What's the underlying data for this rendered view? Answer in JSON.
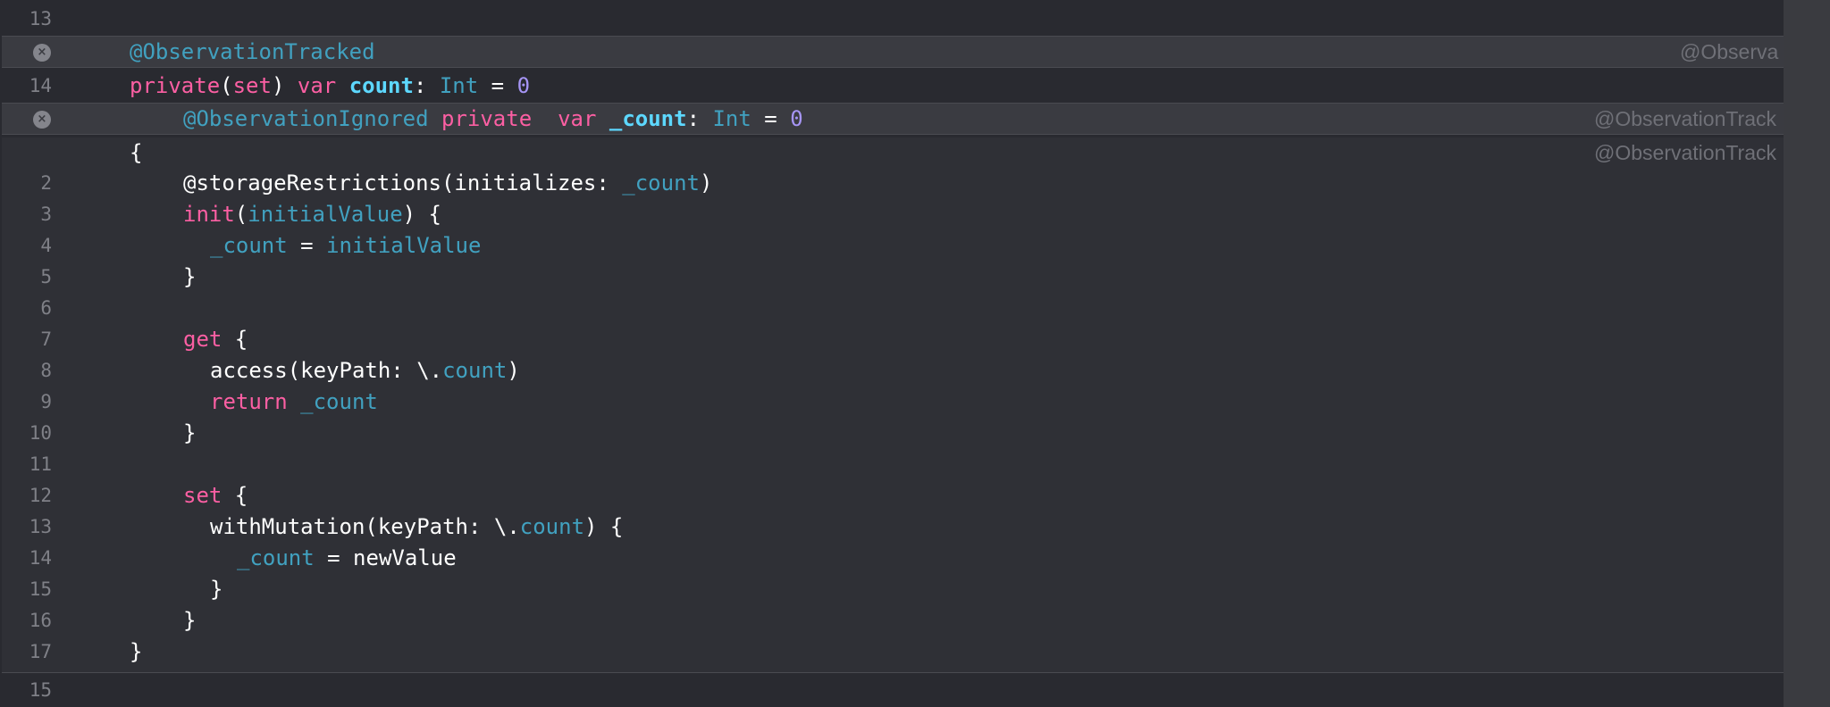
{
  "top_line": {
    "number": "13",
    "text": ""
  },
  "banner1": {
    "code": "@ObservationTracked",
    "hint": "@Observa"
  },
  "line14": {
    "number": "14",
    "tokens": {
      "t1": "private",
      "t2": "(",
      "t3": "set",
      "t4": ") ",
      "t5": "var",
      "t6": " ",
      "t7": "count",
      "t8": ": ",
      "t9": "Int",
      "t10": " = ",
      "t11": "0"
    }
  },
  "banner2": {
    "tokens": {
      "t1": "@ObservationIgnored",
      "t2": " ",
      "t3": "private",
      "t4": "  ",
      "t5": "var",
      "t6": " ",
      "t7": "_count",
      "t8": ": ",
      "t9": "Int",
      "t10": " = ",
      "t11": "0"
    },
    "hint": "@ObservationTrack"
  },
  "expansion": {
    "hint": "@ObservationTrack",
    "open_brace": "{",
    "lines": [
      {
        "number": "2",
        "parts": [
          "@storageRestrictions(initializes: ",
          "_count",
          ")"
        ]
      },
      {
        "number": "3",
        "parts": [
          "init",
          "(",
          "initialValue",
          ") {"
        ]
      },
      {
        "number": "4",
        "parts": [
          "_count",
          " = ",
          "initialValue"
        ]
      },
      {
        "number": "5",
        "parts": [
          "}"
        ]
      },
      {
        "number": "6",
        "parts": [
          ""
        ]
      },
      {
        "number": "7",
        "parts": [
          "get",
          " {"
        ]
      },
      {
        "number": "8",
        "parts": [
          "access(keyPath: \\.",
          "count",
          ")"
        ]
      },
      {
        "number": "9",
        "parts": [
          "return",
          " ",
          "_count"
        ]
      },
      {
        "number": "10",
        "parts": [
          "}"
        ]
      },
      {
        "number": "11",
        "parts": [
          ""
        ]
      },
      {
        "number": "12",
        "parts": [
          "set",
          " {"
        ]
      },
      {
        "number": "13",
        "parts": [
          "withMutation(keyPath: \\.",
          "count",
          ") {"
        ]
      },
      {
        "number": "14",
        "parts": [
          "_count",
          " = newValue"
        ]
      },
      {
        "number": "15",
        "parts": [
          "}"
        ]
      },
      {
        "number": "16",
        "parts": [
          "}"
        ]
      },
      {
        "number": "17",
        "parts": [
          "}"
        ]
      }
    ]
  },
  "bottom_line": {
    "number": "15"
  },
  "colors": {
    "background": "#292a30",
    "keyword": "#fc5fa3",
    "type": "#5dd8ff",
    "attribute": "#41a1c0",
    "number": "#a695f5",
    "plain": "#ffffff",
    "line_number": "#7f8087"
  }
}
